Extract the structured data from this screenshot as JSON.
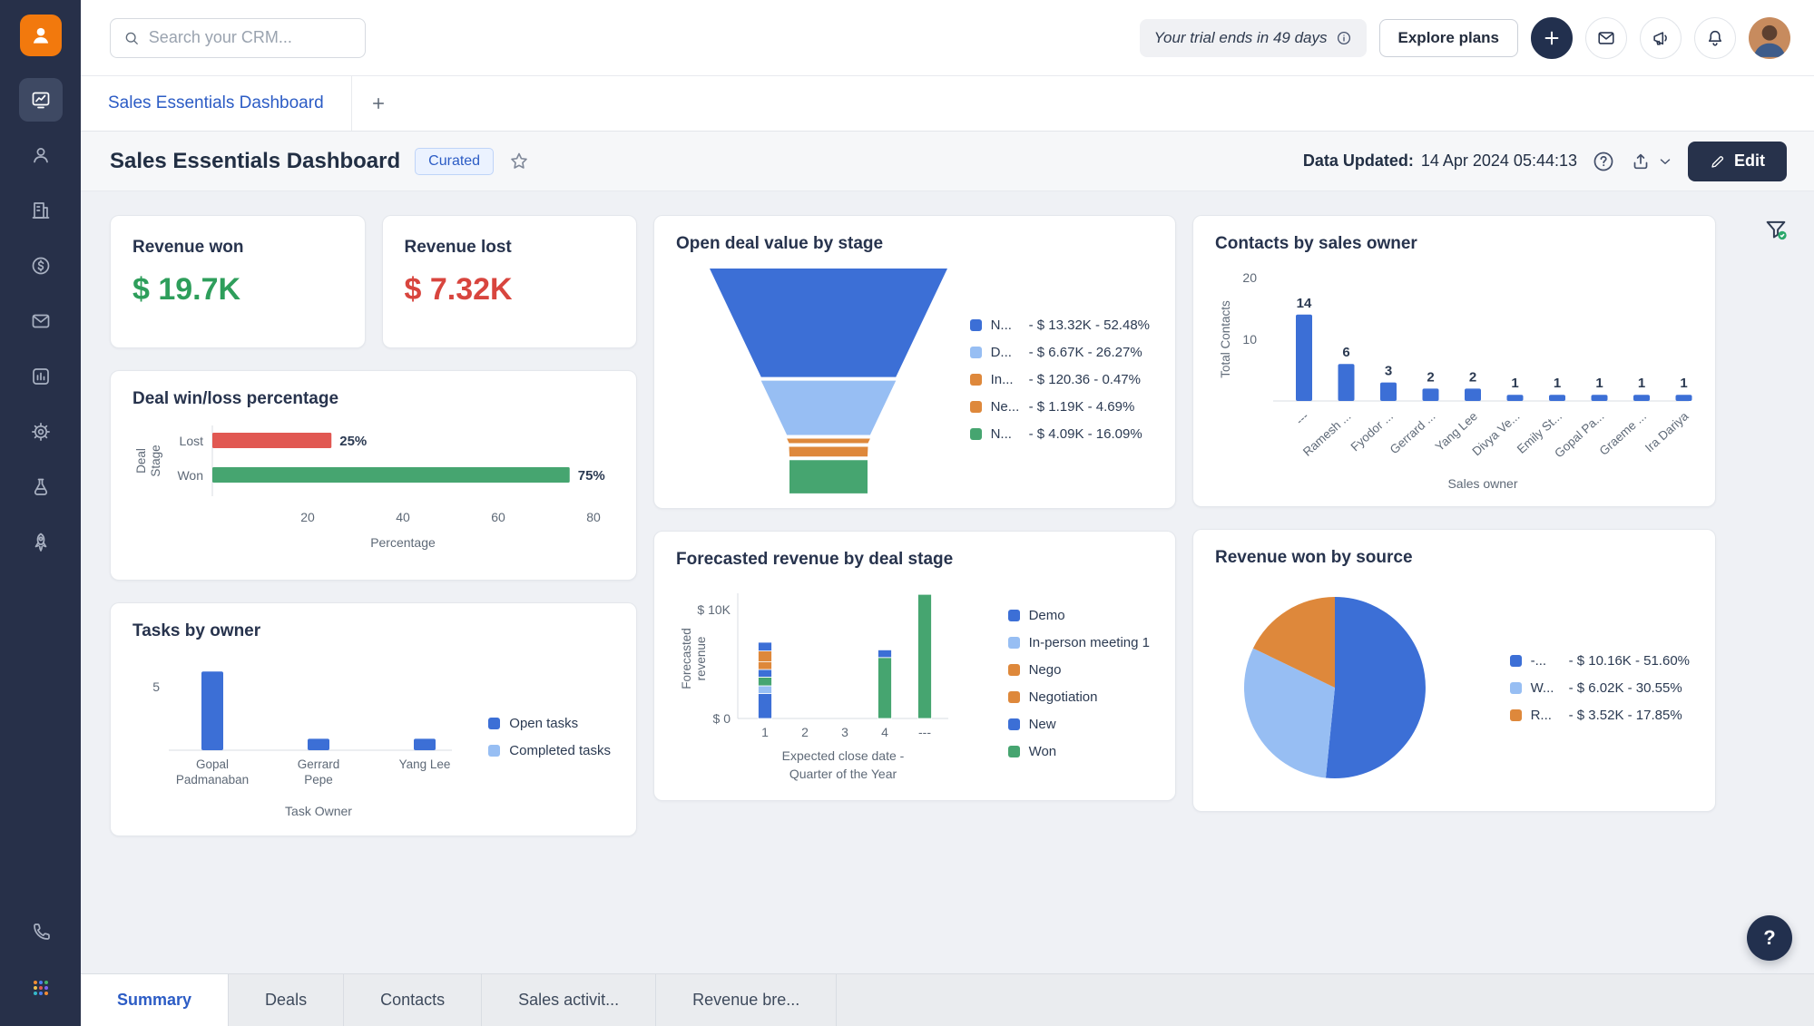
{
  "palette": {
    "blue": "#3C6FD6",
    "lightblue": "#97BEF3",
    "orange": "#DE883B",
    "green": "#46A570",
    "red": "#E15852",
    "accent": "#2C5CC5",
    "axis_text": "#5E6977",
    "value_text": "#2B3A52"
  },
  "sidebar": {
    "items": [
      "dashboard",
      "contacts",
      "accounts",
      "deals",
      "email",
      "analytics",
      "settings",
      "labs",
      "rocket"
    ],
    "bottom_items": [
      "phone",
      "apps"
    ],
    "active_item": "dashboard"
  },
  "topbar": {
    "search_placeholder": "Search your CRM...",
    "trial_text": "Your trial ends in 49 days",
    "explore_button": "Explore plans"
  },
  "tabstrip": {
    "active_tab": "Sales Essentials Dashboard"
  },
  "page_header": {
    "title": "Sales Essentials Dashboard",
    "badge": "Curated",
    "updated_label": "Data Updated:",
    "updated_value": "14 Apr 2024 05:44:13",
    "edit_button": "Edit"
  },
  "kpis": {
    "revenue_won": {
      "title": "Revenue won",
      "value": "$ 19.7K",
      "color": "#2E9E5B"
    },
    "revenue_lost": {
      "title": "Revenue lost",
      "value": "$ 7.32K",
      "color": "#D8453E"
    }
  },
  "chart_data": [
    {
      "id": "win_loss",
      "type": "bar",
      "orientation": "horizontal",
      "title": "Deal win/loss percentage",
      "categories": [
        "Lost",
        "Won"
      ],
      "values": [
        25,
        75
      ],
      "value_labels": [
        "25%",
        "75%"
      ],
      "bar_colors": [
        "red",
        "green"
      ],
      "xticks": [
        20,
        40,
        60,
        80
      ],
      "xlim": [
        0,
        80
      ],
      "xlabel": "Percentage",
      "ylabel": "Deal Stage"
    },
    {
      "id": "open_deal_funnel",
      "type": "funnel",
      "title": "Open deal value by stage",
      "items": [
        {
          "label": "N...",
          "value": "$ 13.32K",
          "pct": 52.48,
          "color": "blue"
        },
        {
          "label": "D...",
          "value": "$ 6.67K",
          "pct": 26.27,
          "color": "lightblue"
        },
        {
          "label": "In...",
          "value": "$ 120.36",
          "pct": 0.47,
          "color": "orange"
        },
        {
          "label": "Ne...",
          "value": "$ 1.19K",
          "pct": 4.69,
          "color": "orange"
        },
        {
          "label": "N...",
          "value": "$ 4.09K",
          "pct": 16.09,
          "color": "green"
        }
      ],
      "legend_position": "right"
    },
    {
      "id": "contacts_by_owner",
      "type": "bar",
      "orientation": "vertical",
      "title": "Contacts by sales owner",
      "categories": [
        "---",
        "Ramesh ...",
        "Fyodor ...",
        "Gerrard ...",
        "Yang Lee",
        "Divya Ve...",
        "Emily St...",
        "Gopal Pa...",
        "Graeme ...",
        "Ira Dariya"
      ],
      "values": [
        14,
        6,
        3,
        2,
        2,
        1,
        1,
        1,
        1,
        1
      ],
      "yticks": [
        10,
        20
      ],
      "ylim": [
        0,
        20
      ],
      "xlabel": "Sales owner",
      "ylabel": "Total Contacts",
      "bar_color": "blue",
      "grid": false
    },
    {
      "id": "forecast_by_stage",
      "type": "stacked-bar",
      "title": "Forecasted revenue by deal stage",
      "categories": [
        "1",
        "2",
        "3",
        "4",
        "---"
      ],
      "yticks": [
        {
          "v": 0,
          "label": "$ 0"
        },
        {
          "v": 10,
          "label": "$ 10K"
        }
      ],
      "ylim": [
        0,
        11.8
      ],
      "xlabel_lines": [
        "Expected close date -",
        "Quarter of the Year"
      ],
      "ylabel_lines": [
        "Forecasted",
        "revenue"
      ],
      "bars": [
        [
          {
            "color": "blue",
            "v": 2.3
          },
          {
            "color": "lightblue",
            "v": 0.7
          },
          {
            "color": "green",
            "v": 0.8
          },
          {
            "color": "blue",
            "v": 0.7
          },
          {
            "color": "orange",
            "v": 0.7
          },
          {
            "color": "orange",
            "v": 1.0
          },
          {
            "color": "blue",
            "v": 0.8
          }
        ],
        [],
        [],
        [
          {
            "color": "green",
            "v": 5.6
          },
          {
            "color": "blue",
            "v": 0.7
          }
        ],
        [
          {
            "color": "green",
            "v": 11.4
          }
        ]
      ],
      "legend": [
        {
          "label": "Demo",
          "color": "blue"
        },
        {
          "label": "In-person meeting 1",
          "color": "lightblue"
        },
        {
          "label": "Nego",
          "color": "orange"
        },
        {
          "label": "Negotiation",
          "color": "orange"
        },
        {
          "label": "New",
          "color": "blue"
        },
        {
          "label": "Won",
          "color": "green"
        }
      ],
      "legend_position": "right"
    },
    {
      "id": "tasks_by_owner",
      "type": "bar",
      "orientation": "vertical",
      "title": "Tasks by owner",
      "categories_lines": [
        [
          "Gopal",
          "Padmanaban"
        ],
        [
          "Gerrard",
          "Pepe"
        ],
        [
          "Yang Lee"
        ]
      ],
      "values": [
        6.2,
        0.9,
        0.9
      ],
      "yticks": [
        5
      ],
      "ylim": [
        0,
        6.6
      ],
      "xlabel": "Task Owner",
      "bar_color": "blue",
      "legend": [
        {
          "label": "Open tasks",
          "color": "blue"
        },
        {
          "label": "Completed tasks",
          "color": "lightblue"
        }
      ],
      "legend_position": "right"
    },
    {
      "id": "revenue_by_source",
      "type": "pie",
      "title": "Revenue won by source",
      "items": [
        {
          "label": "-...",
          "value": "$ 10.16K",
          "pct": 51.6,
          "color": "blue"
        },
        {
          "label": "W...",
          "value": "$ 6.02K",
          "pct": 30.55,
          "color": "lightblue"
        },
        {
          "label": "R...",
          "value": "$ 3.52K",
          "pct": 17.85,
          "color": "orange"
        }
      ],
      "legend_position": "right"
    }
  ],
  "bottom_tabs": {
    "items": [
      "Summary",
      "Deals",
      "Contacts",
      "Sales activit...",
      "Revenue bre..."
    ],
    "active_index": 0
  },
  "help_fab": "?"
}
